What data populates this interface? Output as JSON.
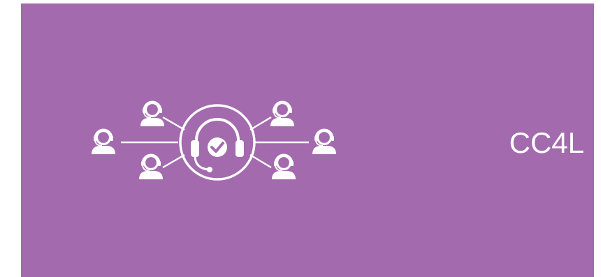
{
  "brand": {
    "name": "CC4L"
  },
  "colors": {
    "background": "#a36aae",
    "foreground": "#ffffff"
  },
  "icons": {
    "emblem": "support-network-icon",
    "agent": "headset-agent-icon",
    "center": "headset-check-icon"
  }
}
